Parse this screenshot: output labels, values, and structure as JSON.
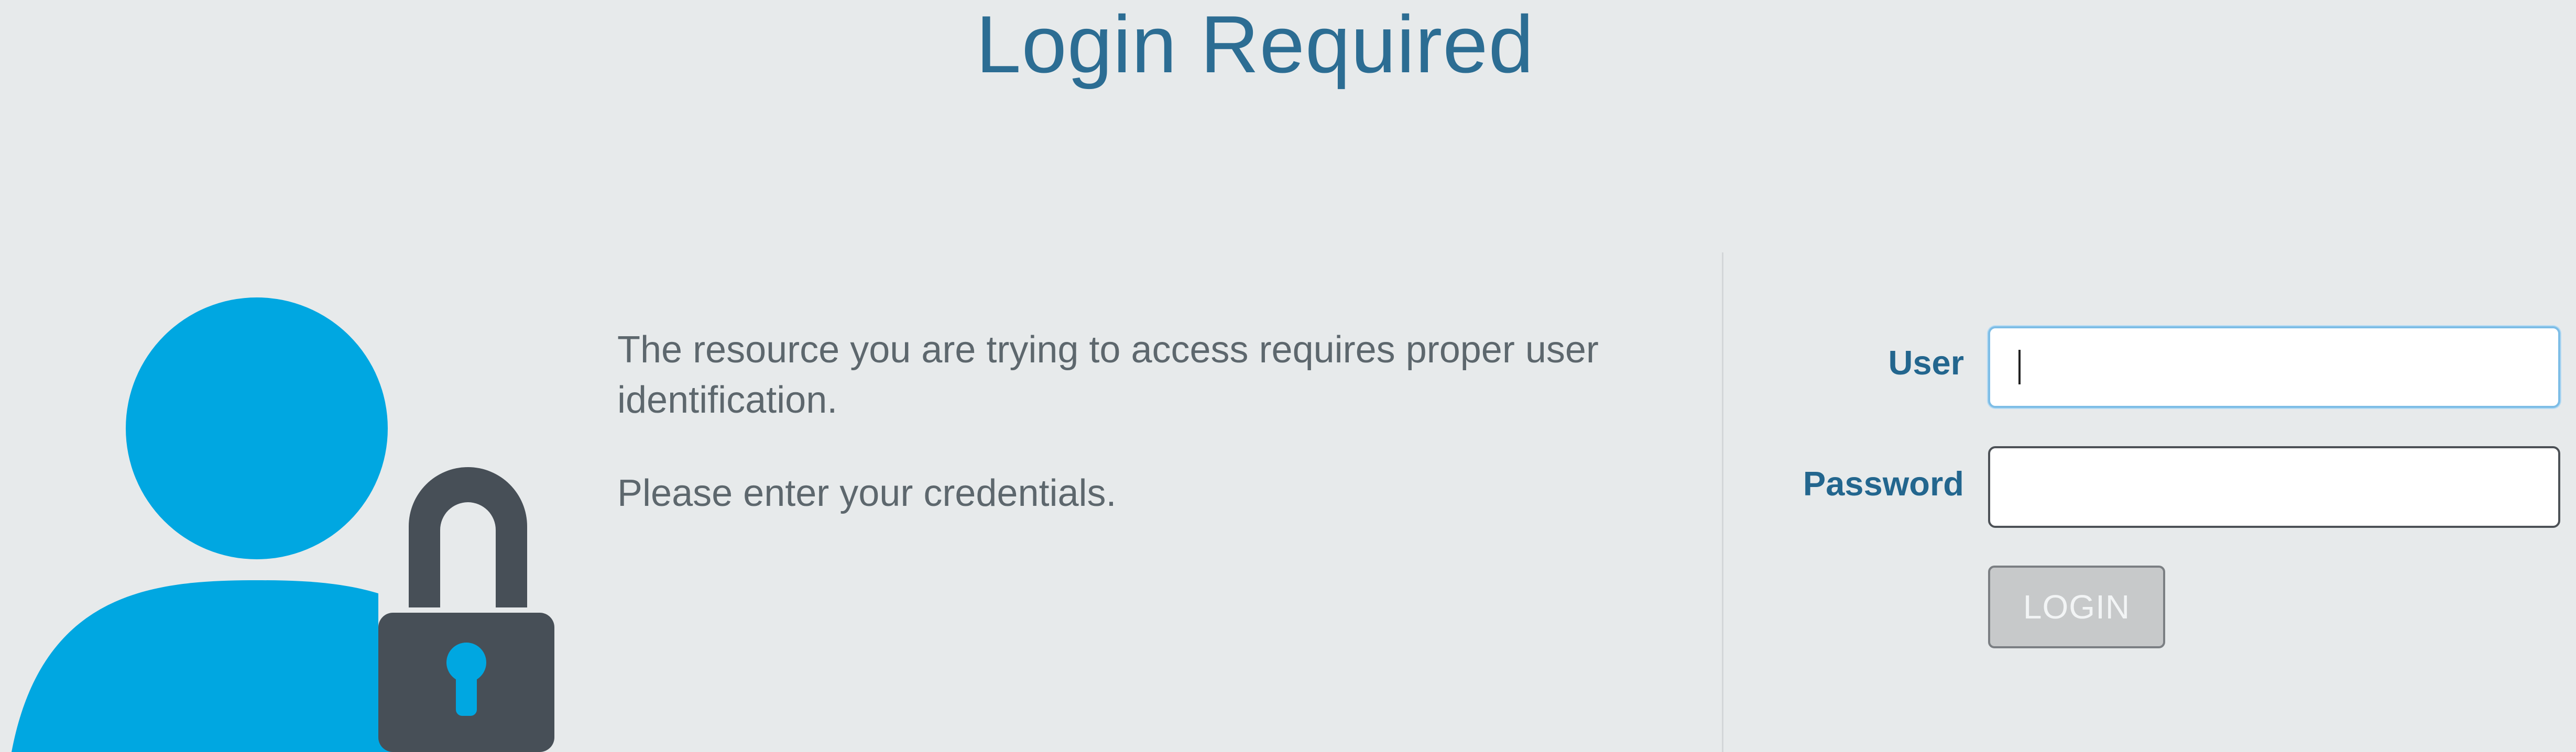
{
  "page": {
    "title": "Login Required"
  },
  "message": {
    "line1": "The resource you are trying to access requires proper user identification.",
    "line2": "Please enter your credentials."
  },
  "form": {
    "user_label": "User",
    "user_value": "",
    "password_label": "Password",
    "password_value": "",
    "login_label": "LOGIN"
  },
  "illustration": {
    "icon": "user-lock-icon",
    "user_color": "#00a7e1",
    "lock_color": "#474f57"
  },
  "colors": {
    "background": "#e7eaeb",
    "title": "#2c6d93",
    "label": "#23668e",
    "button_disabled": "#c7c9ca"
  }
}
